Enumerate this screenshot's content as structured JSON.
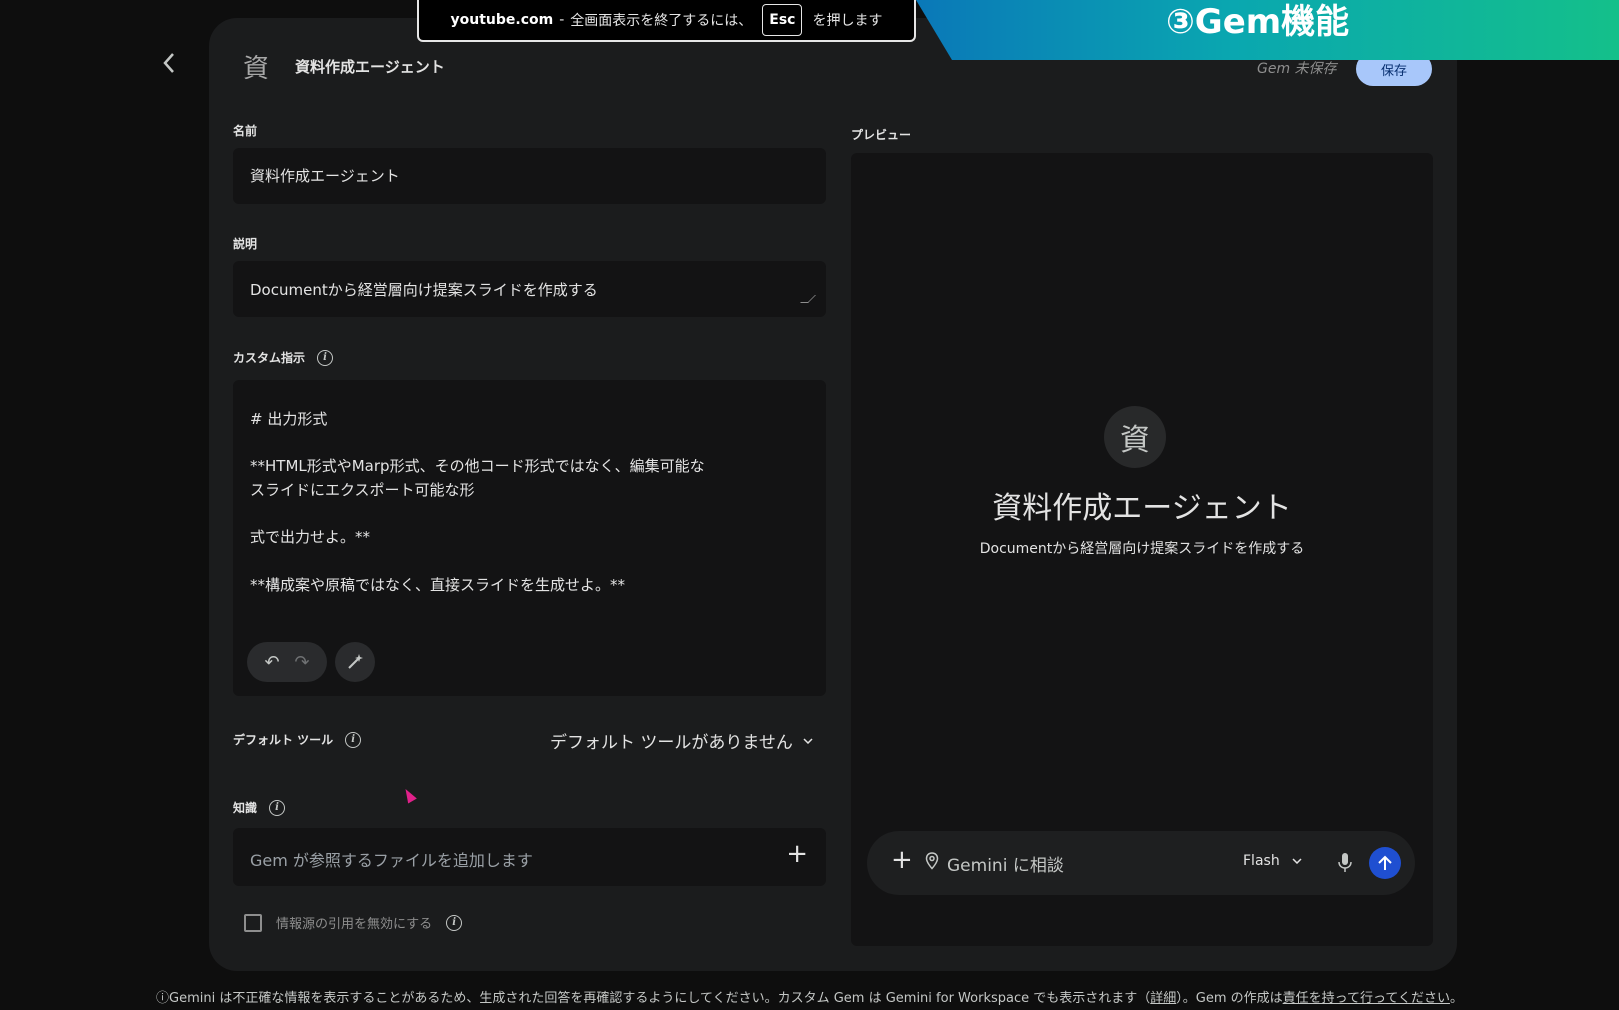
{
  "fullscreen_notice": {
    "domain": "youtube.com",
    "separator": "-",
    "message_before": "全画面表示を終了するには、",
    "key": "Esc",
    "message_after": "を押します"
  },
  "banner": {
    "text": "③Gem機能"
  },
  "header": {
    "avatar_char": "資",
    "title": "資料作成エージェント",
    "unsaved_status": "Gem 未保存",
    "save_label": "保存"
  },
  "form": {
    "name_label": "名前",
    "name_value": "資料作成エージェント",
    "description_label": "説明",
    "description_value": "Documentから経営層向け提案スライドを作成する",
    "instructions_label": "カスタム指示",
    "instructions_lines": [
      "# 出力形式",
      "**HTML形式やMarp形式、その他コード形式ではなく、編集可能な",
      "スライドにエクスポート可能な形",
      "式で出力せよ。**",
      "**構成案や原稿ではなく、直接スライドを生成せよ。**"
    ],
    "tools_label": "デフォルト ツール",
    "tools_value": "デフォルト ツールがありません",
    "knowledge_label": "知識",
    "knowledge_placeholder": "Gem が参照するファイルを追加します",
    "cite_label": "情報源の引用を無効にする"
  },
  "preview": {
    "label": "プレビュー",
    "avatar_char": "資",
    "title": "資料作成エージェント",
    "description": "Documentから経営層向け提案スライドを作成する",
    "chat_placeholder": "Gemini に相談",
    "model": "Flash"
  },
  "footer": {
    "text_before": "ⓘGemini は不正確な情報を表示することがあるため、生成された回答を再確認するようにしてください。カスタム Gem は Gemini for Workspace でも表示されます（",
    "link_details": "詳細",
    "text_middle": "）。Gem の作成は",
    "link_responsibility": "責任を持って行ってください",
    "text_after": "。"
  },
  "colors": {
    "background": "#0e0e0e",
    "card": "#1b1c1d",
    "input": "#131314",
    "save_button": "#a8c7fa",
    "send_button": "#1f4fd1",
    "cursor": "#e0218a"
  }
}
